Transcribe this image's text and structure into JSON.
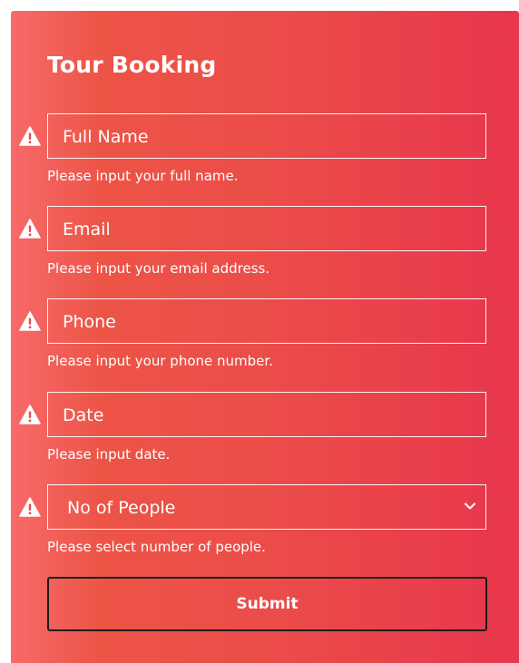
{
  "form": {
    "title": "Tour Booking",
    "fields": [
      {
        "placeholder": "Full Name",
        "help": "Please input your full name.",
        "icon": "warning-icon"
      },
      {
        "placeholder": "Email",
        "help": "Please input your email address.",
        "icon": "warning-icon"
      },
      {
        "placeholder": "Phone",
        "help": "Please input your phone number.",
        "icon": "warning-icon"
      },
      {
        "placeholder": "Date",
        "help": "Please input date.",
        "icon": "warning-icon"
      }
    ],
    "people_select": {
      "selected": "No of People",
      "help": "Please select number of people.",
      "icon": "warning-icon",
      "dropdown_icon": "chevron-down-icon"
    },
    "submit_label": "Submit"
  },
  "colors": {
    "gradient_start": "#f76a6a",
    "gradient_end": "#e8364c",
    "text": "#ffffff",
    "submit_border": "#1c1c1c"
  }
}
